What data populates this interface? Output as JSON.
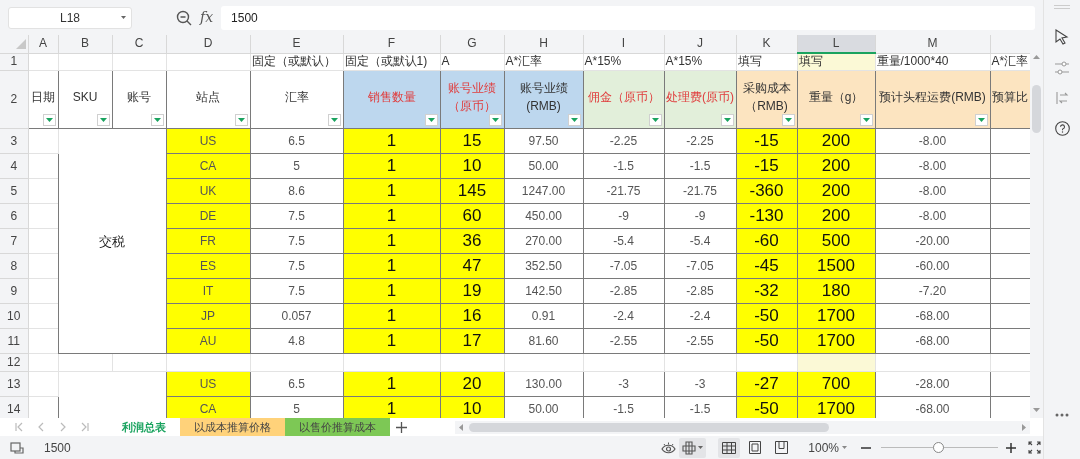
{
  "toolbar": {
    "name_box": "L18",
    "fx": "fx",
    "formula": "1500"
  },
  "columns": [
    {
      "label": "A",
      "selected": false
    },
    {
      "label": "B",
      "selected": false
    },
    {
      "label": "C",
      "selected": false
    },
    {
      "label": "D",
      "selected": false
    },
    {
      "label": "E",
      "selected": false
    },
    {
      "label": "F",
      "selected": false
    },
    {
      "label": "G",
      "selected": false
    },
    {
      "label": "H",
      "selected": false
    },
    {
      "label": "I",
      "selected": false
    },
    {
      "label": "J",
      "selected": false
    },
    {
      "label": "K",
      "selected": false
    },
    {
      "label": "L",
      "selected": true
    },
    {
      "label": "M",
      "selected": false
    }
  ],
  "row1": {
    "num": "1",
    "cells": {
      "E": "固定（或默认）",
      "F": "固定（或默认1)",
      "G": "A",
      "H": "A*汇率",
      "I": "A*15%",
      "J": "A*15%",
      "K": "填写",
      "L": "填写",
      "M": "重量/1000*40",
      "N": "A*汇率"
    }
  },
  "row2": {
    "num": "2",
    "headers": [
      {
        "text": "日期",
        "color": "#ffffff",
        "emphasis": false,
        "filter": true
      },
      {
        "text": "SKU",
        "color": "#ffffff",
        "emphasis": false,
        "filter": true
      },
      {
        "text": "账号",
        "color": "#ffffff",
        "emphasis": false,
        "filter": true
      },
      {
        "text": "站点",
        "color": "#ffffff",
        "emphasis": false,
        "filter": true
      },
      {
        "text": "汇率",
        "color": "#ffffff",
        "emphasis": false,
        "filter": true
      },
      {
        "text": "销售数量",
        "color": "#bdd7ee",
        "emphasis": true,
        "filter": true
      },
      {
        "text": "账号业绩（原币）",
        "color": "#bdd7ee",
        "emphasis": true,
        "filter": true
      },
      {
        "text": "账号业绩(RMB)",
        "color": "#bdd7ee",
        "emphasis": false,
        "filter": true
      },
      {
        "text": "佣金（原币）",
        "color": "#e2efda",
        "emphasis": true,
        "filter": true
      },
      {
        "text": "处理费(原币)",
        "color": "#e2efda",
        "emphasis": true,
        "filter": true
      },
      {
        "text": "采购成本（RMB)",
        "color": "#fce4c0",
        "emphasis": false,
        "filter": true
      },
      {
        "text": "重量（g）",
        "color": "#fce4c0",
        "emphasis": false,
        "filter": true
      },
      {
        "text": "预计头程运费(RMB)",
        "color": "#fce4c0",
        "emphasis": false,
        "filter": true
      },
      {
        "text": "预算比",
        "color": "#fce4c0",
        "emphasis": false,
        "filter": false
      }
    ]
  },
  "data_columns": [
    {
      "highlighted": true,
      "large_text": false
    },
    {
      "highlighted": false,
      "large_text": false
    },
    {
      "highlighted": true,
      "large_text": true
    },
    {
      "highlighted": true,
      "large_text": true
    },
    {
      "highlighted": false,
      "large_text": false
    },
    {
      "highlighted": false,
      "large_text": false
    },
    {
      "highlighted": false,
      "large_text": false
    },
    {
      "highlighted": true,
      "large_text": true
    },
    {
      "highlighted": true,
      "large_text": true
    },
    {
      "highlighted": false,
      "large_text": false
    }
  ],
  "blocks": [
    {
      "kind": "group",
      "label": "交税",
      "rows": [
        {
          "num": "3",
          "cells": [
            "US",
            "6.5",
            "1",
            "15",
            "97.50",
            "-2.25",
            "-2.25",
            "-15",
            "200",
            "-8.00"
          ]
        },
        {
          "num": "4",
          "cells": [
            "CA",
            "5",
            "1",
            "10",
            "50.00",
            "-1.5",
            "-1.5",
            "-15",
            "200",
            "-8.00"
          ]
        },
        {
          "num": "5",
          "cells": [
            "UK",
            "8.6",
            "1",
            "145",
            "1247.00",
            "-21.75",
            "-21.75",
            "-360",
            "200",
            "-8.00"
          ]
        },
        {
          "num": "6",
          "cells": [
            "DE",
            "7.5",
            "1",
            "60",
            "450.00",
            "-9",
            "-9",
            "-130",
            "200",
            "-8.00"
          ]
        },
        {
          "num": "7",
          "cells": [
            "FR",
            "7.5",
            "1",
            "36",
            "270.00",
            "-5.4",
            "-5.4",
            "-60",
            "500",
            "-20.00"
          ]
        },
        {
          "num": "8",
          "cells": [
            "ES",
            "7.5",
            "1",
            "47",
            "352.50",
            "-7.05",
            "-7.05",
            "-45",
            "1500",
            "-60.00"
          ]
        },
        {
          "num": "9",
          "cells": [
            "IT",
            "7.5",
            "1",
            "19",
            "142.50",
            "-2.85",
            "-2.85",
            "-32",
            "180",
            "-7.20"
          ]
        },
        {
          "num": "10",
          "cells": [
            "JP",
            "0.057",
            "1",
            "16",
            "0.91",
            "-2.4",
            "-2.4",
            "-50",
            "1700",
            "-68.00"
          ]
        },
        {
          "num": "11",
          "cells": [
            "AU",
            "4.8",
            "1",
            "17",
            "81.60",
            "-2.55",
            "-2.55",
            "-50",
            "1700",
            "-68.00"
          ]
        }
      ]
    },
    {
      "kind": "blank",
      "num": "12"
    },
    {
      "kind": "group",
      "rows": [
        {
          "num": "13",
          "cells": [
            "US",
            "6.5",
            "1",
            "20",
            "130.00",
            "-3",
            "-3",
            "-27",
            "700",
            "-28.00"
          ]
        },
        {
          "num": "14",
          "cells": [
            "CA",
            "5",
            "1",
            "10",
            "50.00",
            "-1.5",
            "-1.5",
            "-50",
            "1700",
            "-68.00"
          ]
        }
      ]
    }
  ],
  "sheet_tabs": [
    {
      "label": "利润总表",
      "selected": true,
      "color": "#ffffff"
    },
    {
      "label": "以成本推算价格",
      "selected": false,
      "color": "#ffd27a"
    },
    {
      "label": "以售价推算成本",
      "selected": false,
      "color": "#7dc855"
    }
  ],
  "status_bar": {
    "value": "1500",
    "view_modes": [
      {
        "kind": "normal",
        "selected": true
      },
      {
        "kind": "page_break",
        "selected": false
      },
      {
        "kind": "page_layout",
        "selected": false
      }
    ],
    "zoom": "100%",
    "zoom_slider": {
      "level": 0.49
    }
  }
}
